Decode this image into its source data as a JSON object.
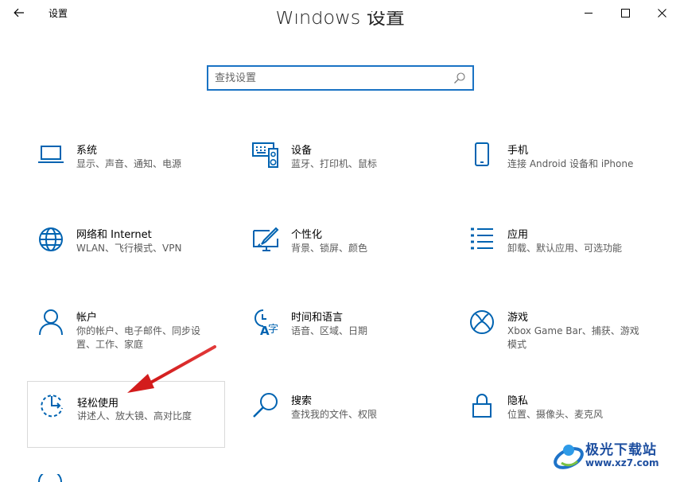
{
  "window": {
    "title": "设置",
    "back_icon": "arrow-left-icon",
    "minimize_icon": "minimize-icon",
    "maximize_icon": "maximize-icon",
    "close_icon": "close-icon"
  },
  "heading": "Windows 设置",
  "search": {
    "placeholder": "查找设置",
    "icon": "search-icon"
  },
  "accent_color": "#0063b1",
  "categories": [
    {
      "title": "系统",
      "desc": "显示、声音、通知、电源",
      "icon": "laptop-icon"
    },
    {
      "title": "设备",
      "desc": "蓝牙、打印机、鼠标",
      "icon": "keyboard-speaker-icon"
    },
    {
      "title": "手机",
      "desc": "连接 Android 设备和 iPhone",
      "icon": "phone-icon"
    },
    {
      "title": "网络和 Internet",
      "desc": "WLAN、飞行模式、VPN",
      "icon": "globe-icon"
    },
    {
      "title": "个性化",
      "desc": "背景、锁屏、颜色",
      "icon": "personalization-icon"
    },
    {
      "title": "应用",
      "desc": "卸载、默认应用、可选功能",
      "icon": "apps-list-icon"
    },
    {
      "title": "帐户",
      "desc": "你的帐户、电子邮件、同步设置、工作、家庭",
      "icon": "person-icon"
    },
    {
      "title": "时间和语言",
      "desc": "语音、区域、日期",
      "icon": "time-language-icon"
    },
    {
      "title": "游戏",
      "desc": "Xbox Game Bar、捕获、游戏模式",
      "icon": "xbox-icon"
    },
    {
      "title": "轻松使用",
      "desc": "讲述人、放大镜、高对比度",
      "icon": "ease-of-access-icon",
      "selected": true
    },
    {
      "title": "搜索",
      "desc": "查找我的文件、权限",
      "icon": "search-icon"
    },
    {
      "title": "隐私",
      "desc": "位置、摄像头、麦克风",
      "icon": "lock-icon"
    }
  ],
  "watermark": {
    "title": "极光下载站",
    "url": "www.xz7.com"
  }
}
